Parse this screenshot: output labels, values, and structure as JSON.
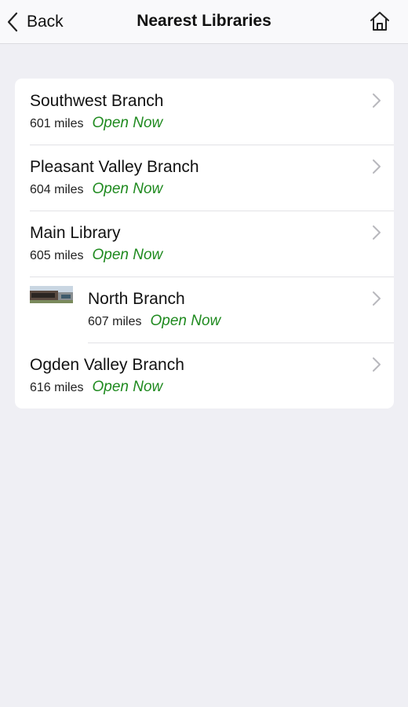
{
  "nav": {
    "back_label": "Back",
    "title": "Nearest Libraries",
    "back_icon": "chevron-left-icon",
    "home_icon": "home-icon"
  },
  "libraries": [
    {
      "name": "Southwest Branch",
      "distance": "601 miles",
      "status": "Open Now"
    },
    {
      "name": "Pleasant Valley Branch",
      "distance": "604 miles",
      "status": "Open Now"
    },
    {
      "name": "Main Library",
      "distance": "605 miles",
      "status": "Open Now"
    },
    {
      "name": "North Branch",
      "distance": "607 miles",
      "status": "Open Now"
    },
    {
      "name": "Ogden Valley Branch",
      "distance": "616 miles",
      "status": "Open Now"
    }
  ],
  "colors": {
    "background": "#efeff4",
    "card": "#ffffff",
    "status_open": "#1f8a1f",
    "chevron": "#b8b8bd"
  }
}
